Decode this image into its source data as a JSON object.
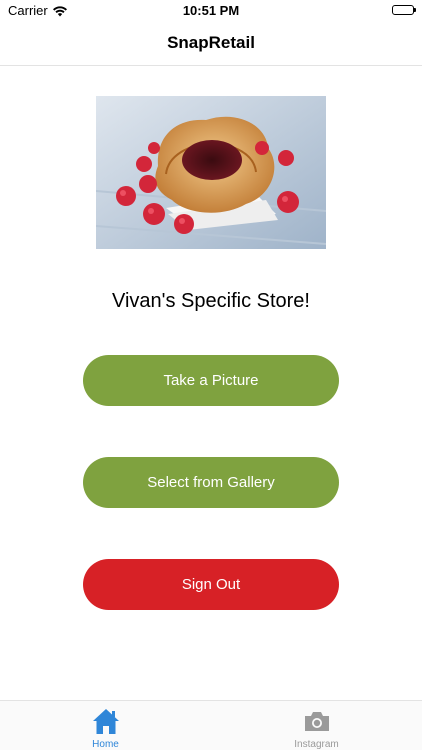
{
  "status_bar": {
    "carrier": "Carrier",
    "time": "10:51 PM",
    "battery_level": 1.0
  },
  "nav": {
    "title": "SnapRetail"
  },
  "main": {
    "hero_icon": "pastry-photo",
    "store_title": "Vivan's Specific Store!",
    "take_picture_label": "Take a Picture",
    "select_gallery_label": "Select from Gallery",
    "sign_out_label": "Sign Out"
  },
  "colors": {
    "accent_green": "#7fa23f",
    "danger_red": "#d72126",
    "tab_active": "#2f86d8",
    "tab_inactive": "#9a9a9a"
  },
  "tabs": [
    {
      "label": "Home",
      "icon": "home-icon",
      "active": true
    },
    {
      "label": "Instagram",
      "icon": "camera-icon",
      "active": false
    }
  ]
}
